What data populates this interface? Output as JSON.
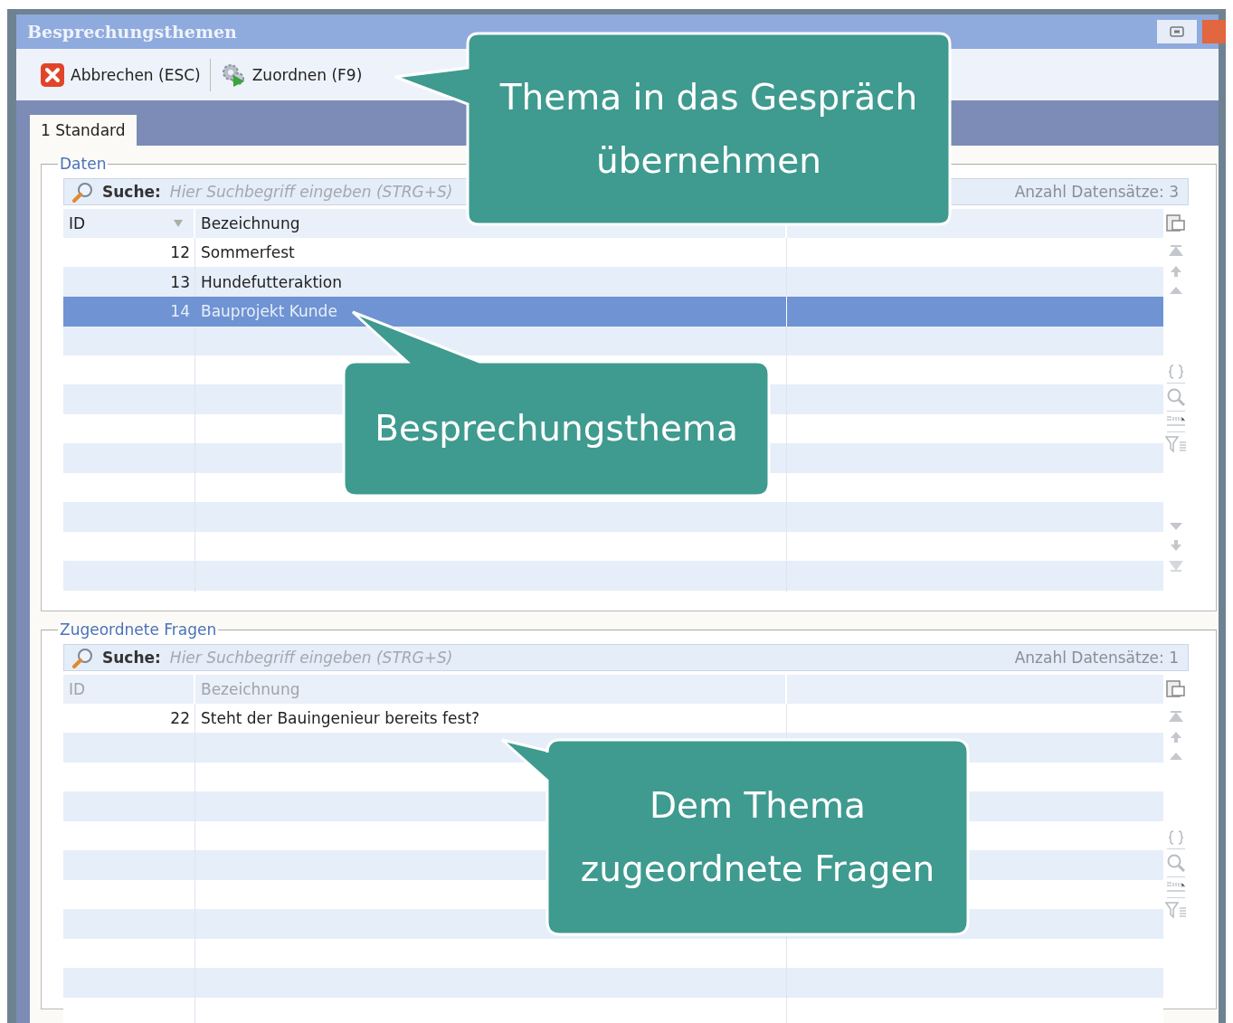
{
  "window": {
    "title": "Besprechungsthemen"
  },
  "toolbar": [
    {
      "label": "Abbrechen (ESC)",
      "kind": "cancel"
    },
    {
      "label": "Zuordnen (F9)",
      "kind": "assign"
    }
  ],
  "tabs": [
    {
      "label": "1 Standard",
      "selected": true
    }
  ],
  "panels": [
    {
      "title": "Daten",
      "search": {
        "label": "Suche:",
        "placeholder": "Hier Suchbegriff eingeben (STRG+S)"
      },
      "count": "Anzahl Datensätze: 3",
      "header_dimmed": false,
      "columns": [
        {
          "label": "ID",
          "sorted": true
        },
        {
          "label": "Bezeichnung",
          "sorted": false
        }
      ],
      "rows": [
        {
          "id": "12",
          "name": "Sommerfest",
          "selected": false
        },
        {
          "id": "13",
          "name": "Hundefutteraktion",
          "selected": false
        },
        {
          "id": "14",
          "name": "Bauprojekt Kunde",
          "selected": true
        }
      ]
    },
    {
      "title": "Zugeordnete Fragen",
      "search": {
        "label": "Suche:",
        "placeholder": "Hier Suchbegriff eingeben (STRG+S)"
      },
      "count": "Anzahl Datensätze: 1",
      "header_dimmed": true,
      "columns": [
        {
          "label": "ID",
          "sorted": false
        },
        {
          "label": "Bezeichnung",
          "sorted": false
        }
      ],
      "rows": [
        {
          "id": "22",
          "name": "Steht der Bauingenieur bereits fest?",
          "selected": false
        }
      ]
    }
  ],
  "callouts": [
    {
      "text": "Thema in das Gespräch übernehmen"
    },
    {
      "text": "Besprechungsthema"
    },
    {
      "text": "Dem Thema zugeordnete Fragen"
    }
  ]
}
